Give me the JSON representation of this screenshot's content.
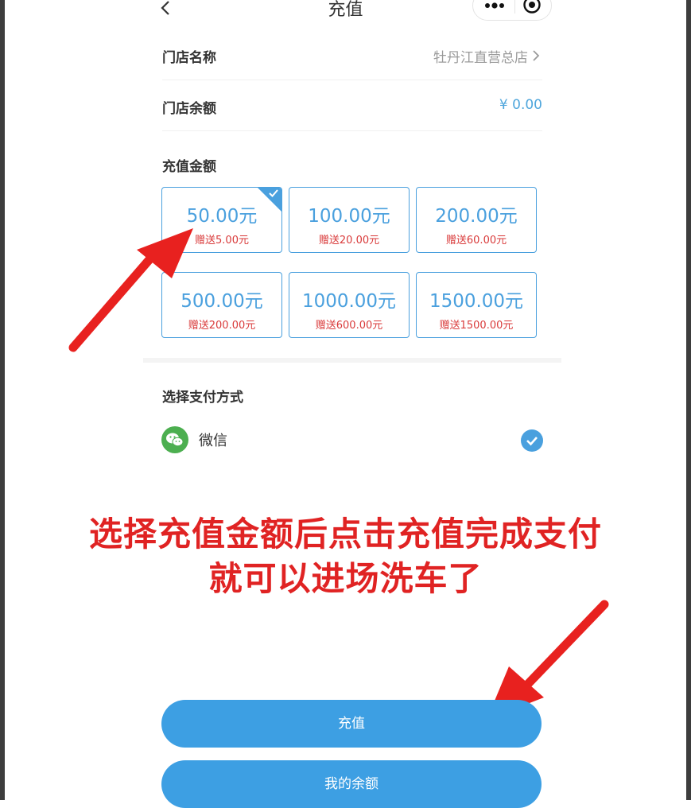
{
  "header": {
    "title": "充值"
  },
  "store": {
    "name_label": "门店名称",
    "name_value": "牡丹江直营总店",
    "balance_label": "门店余额",
    "balance_value": "¥ 0.00"
  },
  "recharge": {
    "title": "充值金额",
    "options": [
      {
        "amount": "50.00元",
        "bonus": "赠送5.00元",
        "selected": true
      },
      {
        "amount": "100.00元",
        "bonus": "赠送20.00元",
        "selected": false
      },
      {
        "amount": "200.00元",
        "bonus": "赠送60.00元",
        "selected": false
      },
      {
        "amount": "500.00元",
        "bonus": "赠送200.00元",
        "selected": false
      },
      {
        "amount": "1000.00元",
        "bonus": "赠送600.00元",
        "selected": false
      },
      {
        "amount": "1500.00元",
        "bonus": "赠送1500.00元",
        "selected": false
      }
    ]
  },
  "payment": {
    "title": "选择支付方式",
    "method_label": "微信",
    "icon": "wechat-icon"
  },
  "annotation": {
    "line1": "选择充值金额后点击充值完成支付",
    "line2": "就可以进场洗车了"
  },
  "buttons": {
    "recharge": "充值",
    "my_balance": "我的余额"
  },
  "colors": {
    "accent": "#4aa0de",
    "button": "#3d9fe3",
    "annotation_red": "#e02323",
    "bonus_red": "#d93a3a",
    "wechat_green": "#4caf50"
  }
}
